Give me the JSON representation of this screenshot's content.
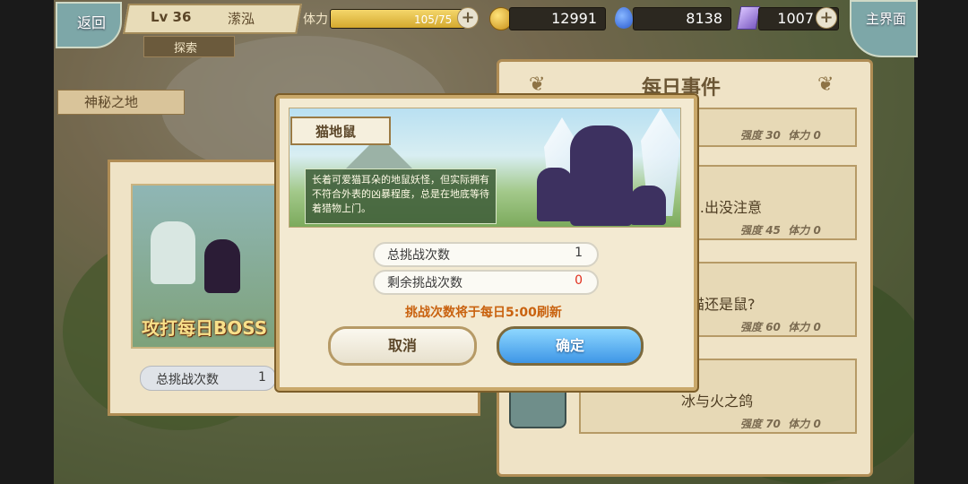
{
  "top_bar": {
    "back_label": "返回",
    "level": "Lv 36",
    "player_name": "潆泓",
    "mode_label": "探索",
    "stamina_label": "体力",
    "stamina_value": "105/75",
    "stamina_fill_fraction": 1.0,
    "gold": "12991",
    "crystal": "8138",
    "gem": "1007",
    "home_label": "主界面"
  },
  "area": {
    "title": "神秘之地"
  },
  "left_card": {
    "banner": "攻打每日BOSS",
    "count_label": "总挑战次数",
    "count_value": "1"
  },
  "right_panel": {
    "title": "每日事件",
    "events": [
      {
        "name": "",
        "strength_label": "强度",
        "strength": "30",
        "stamina_label": "体力",
        "stamina": "0"
      },
      {
        "name": "…出没注意",
        "strength_label": "强度",
        "strength": "45",
        "stamina_label": "体力",
        "stamina": "0"
      },
      {
        "name": "猫还是鼠?",
        "strength_label": "强度",
        "strength": "60",
        "stamina_label": "体力",
        "stamina": "0"
      },
      {
        "name": "冰与火之鸽",
        "strength_label": "强度",
        "strength": "70",
        "stamina_label": "体力",
        "stamina": "0"
      }
    ]
  },
  "modal": {
    "boss_name": "猫地鼠",
    "description": "长着可爱猫耳朵的地鼠妖怪，但实际拥有不符合外表的凶暴程度，总是在地底等待着猎物上门。",
    "total_label": "总挑战次数",
    "total_value": "1",
    "remaining_label": "剩余挑战次数",
    "remaining_value": "0",
    "refresh_note": "挑战次数将于每日5:00刷新",
    "cancel_label": "取消",
    "confirm_label": "确定",
    "colors": {
      "remaining_value": "#e0301e",
      "refresh_note": "#c9620f",
      "confirm_button": "#3e96e6"
    }
  }
}
